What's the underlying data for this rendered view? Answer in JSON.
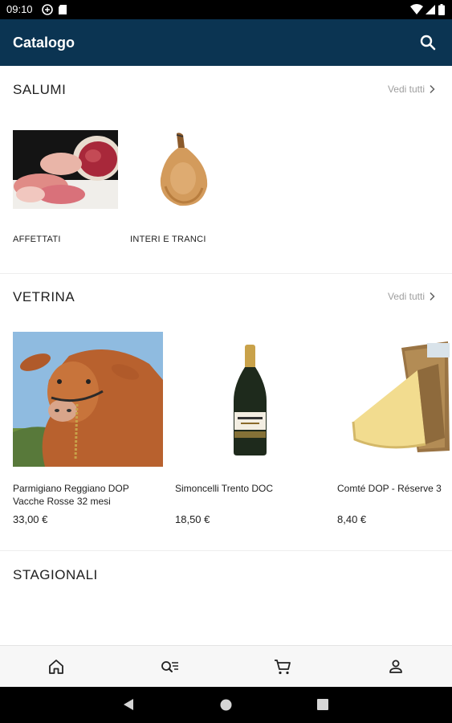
{
  "status_bar": {
    "time": "09:10"
  },
  "app_bar": {
    "title": "Catalogo",
    "search_icon": "search-icon"
  },
  "sections": {
    "salumi": {
      "title": "SALUMI",
      "see_all": "Vedi tutti",
      "categories": [
        {
          "label": "AFFETTATI"
        },
        {
          "label": "INTERI E TRANCI"
        }
      ]
    },
    "vetrina": {
      "title": "VETRINA",
      "see_all": "Vedi tutti",
      "products": [
        {
          "name": "Parmigiano Reggiano DOP Vacche Rosse 32 mesi",
          "price": "33,00 €"
        },
        {
          "name": "Simoncelli Trento DOC",
          "price": "18,50 €"
        },
        {
          "name": "Comté DOP - Réserve 3",
          "price": "8,40 €"
        }
      ]
    },
    "stagionali": {
      "title": "STAGIONALI"
    }
  },
  "bottom_nav": [
    "home-icon",
    "search-list-icon",
    "cart-icon",
    "account-icon"
  ],
  "colors": {
    "app_bar": "#0b3452",
    "see_all": "#9e9e9e"
  }
}
